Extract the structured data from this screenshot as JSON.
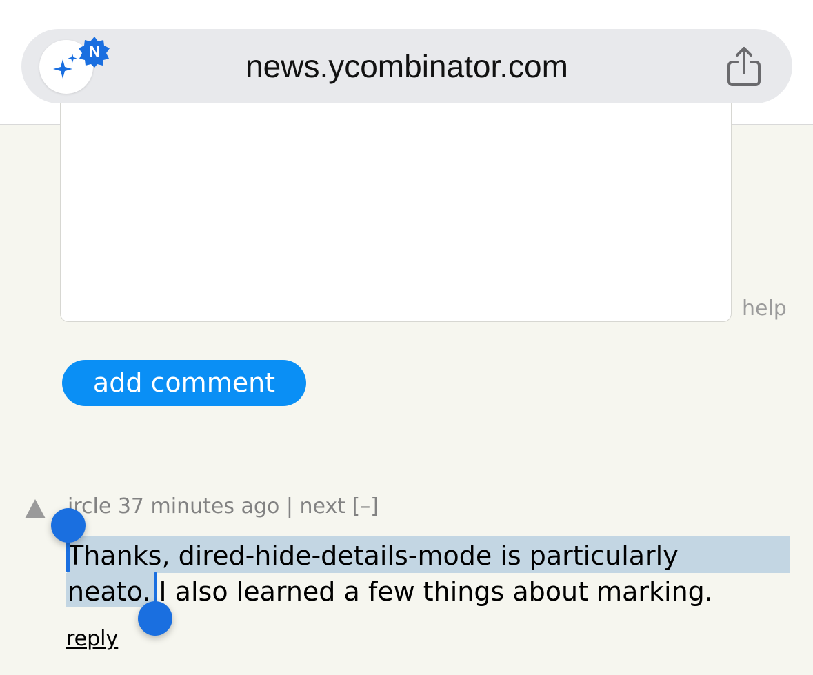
{
  "browser": {
    "url": "news.ycombinator.com",
    "extension_badge": "N",
    "extension_icon": "sparkles-icon",
    "share_icon": "share-icon"
  },
  "reply_form": {
    "help_label": "help",
    "submit_label": "add comment"
  },
  "comment": {
    "author_visible": "ircle",
    "age": "37 minutes ago",
    "separator": "|",
    "next_label": "next",
    "collapse_label": "[–]",
    "text_line1": "Thanks, dired-hide-details-mode is particularly",
    "text_line2": "neato. I also learned a few things about marking.",
    "reply_label": "reply"
  },
  "colors": {
    "accent": "#0a8ff5",
    "selection": "#c3d6e3",
    "handle": "#1a6fe0",
    "page_bg": "#f6f6ef"
  }
}
